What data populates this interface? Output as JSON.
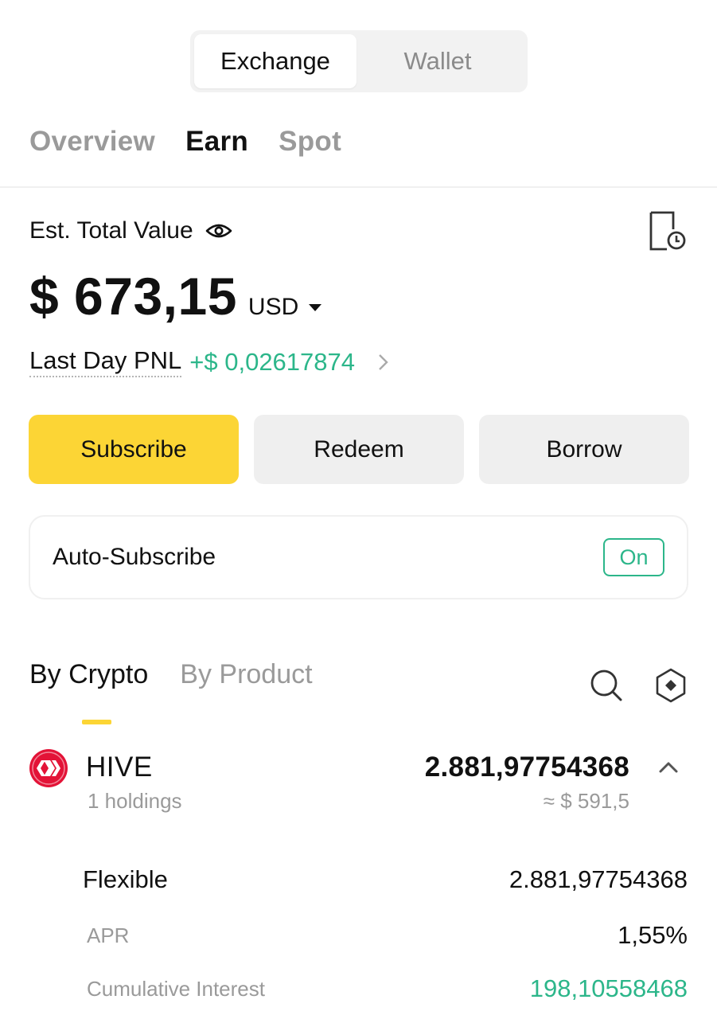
{
  "segmented": {
    "options": [
      "Exchange",
      "Wallet"
    ],
    "active": "Exchange"
  },
  "top_tabs": [
    "Overview",
    "Earn",
    "Spot"
  ],
  "summary": {
    "label": "Est. Total Value",
    "value": "$ 673,15",
    "currency": "USD",
    "pnl_label": "Last Day PNL",
    "pnl_value": "+$ 0,02617874"
  },
  "actions": {
    "subscribe": "Subscribe",
    "redeem": "Redeem",
    "borrow": "Borrow"
  },
  "auto_subscribe": {
    "label": "Auto-Subscribe",
    "status": "On"
  },
  "section_tabs": [
    "By Crypto",
    "By Product"
  ],
  "asset": {
    "name": "HIVE",
    "holdings": "1 holdings",
    "amount": "2.881,97754368",
    "usd": "≈ $ 591,5",
    "icon": "hive-logo-icon"
  },
  "details": {
    "product": "Flexible",
    "product_amount": "2.881,97754368",
    "apr_label": "APR",
    "apr_value": "1,55%",
    "interest_label": "Cumulative Interest",
    "interest_value": "198,10558468"
  },
  "colors": {
    "accent_yellow": "#fcd535",
    "positive_green": "#2cb68a",
    "hive_red": "#e31337"
  }
}
